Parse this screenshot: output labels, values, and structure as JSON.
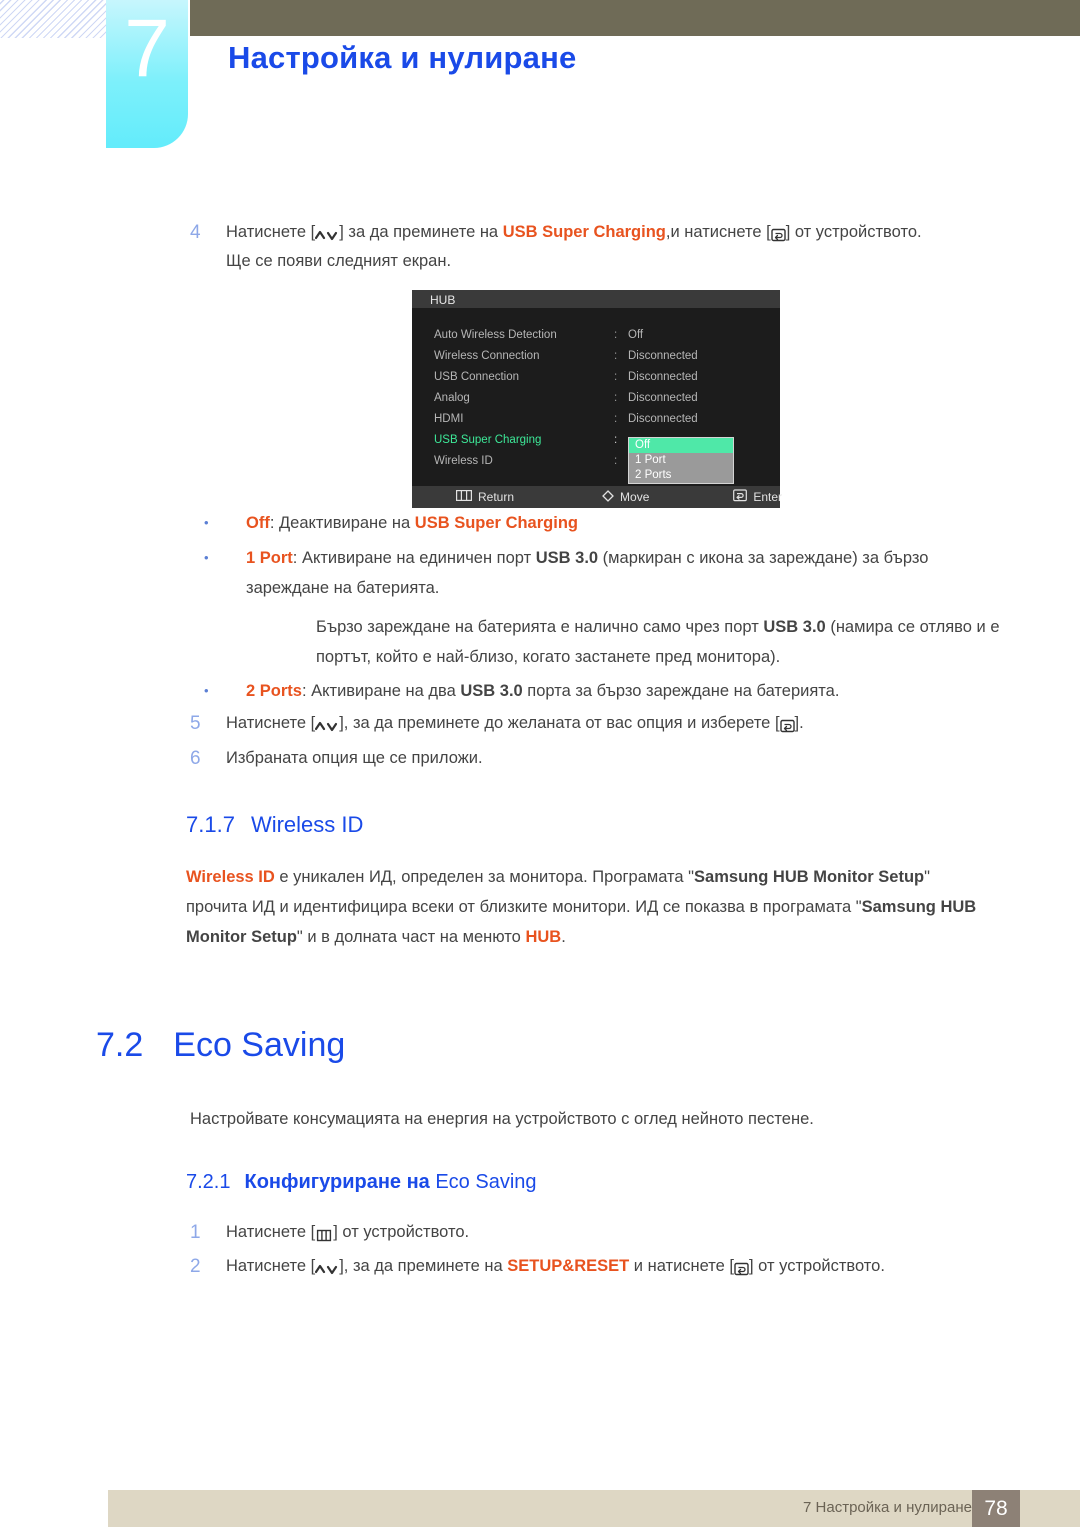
{
  "header": {
    "chapter_number": "7",
    "chapter_title": "Настройка и нулиране"
  },
  "steps_top": [
    {
      "num": "4",
      "line1_a": "Натиснете [",
      "line1_key": "updown-key-icon",
      "line1_b": "] за да преминете на ",
      "line1_highlight": "USB Super Charging",
      "line1_c": ",и натиснете [",
      "line1_key2": "enter-key-icon",
      "line1_d": "] от устройството.",
      "line2": "Ще се появи следният екран."
    }
  ],
  "osd": {
    "title": "HUB",
    "rows": [
      {
        "label": "Auto Wireless Detection",
        "colon": ":",
        "value": "Off",
        "active": false
      },
      {
        "label": "Wireless Connection",
        "colon": ":",
        "value": "Disconnected",
        "active": false
      },
      {
        "label": "USB Connection",
        "colon": ":",
        "value": "Disconnected",
        "active": false
      },
      {
        "label": "Analog",
        "colon": ":",
        "value": "Disconnected",
        "active": false
      },
      {
        "label": "HDMI",
        "colon": ":",
        "value": "Disconnected",
        "active": false
      },
      {
        "label": "USB Super Charging",
        "colon": ":",
        "value": "",
        "active": true
      },
      {
        "label": "Wireless ID",
        "colon": ":",
        "value": "",
        "active": false
      }
    ],
    "dropdown": {
      "options": [
        "Off",
        "1 Port",
        "2 Ports"
      ],
      "selected": "Off"
    },
    "footer": [
      {
        "icon": "menu-key-icon",
        "label": "Return"
      },
      {
        "icon": "move-diamond-icon",
        "label": "Move"
      },
      {
        "icon": "enter-key-icon",
        "label": "Enter"
      }
    ]
  },
  "bullets": [
    {
      "marker": "•",
      "term": "Off",
      "sep": ": ",
      "text_a": "Деактивиране на ",
      "highlight": "USB Super Charging",
      "text_b": ""
    },
    {
      "marker": "•",
      "term": "1 Port",
      "sep": ": ",
      "text_a": "Активиране на единичен порт ",
      "bold": "USB 3.0",
      "text_b": " (маркиран с икона за зареждане) за бързо зареждане на батерията."
    },
    {
      "marker": "•",
      "term": "2 Ports",
      "sep": ": ",
      "text_a": "Активиране на два ",
      "bold": "USB 3.0",
      "text_b": " порта за бързо зареждане на батерията."
    }
  ],
  "note": {
    "text_a": "Бързо зареждане на батерията е налично само чрез порт ",
    "bold": "USB 3.0",
    "text_b": " (намира се отляво и е портът, който е най-близо, когато застанете пред монитора)."
  },
  "steps_mid": [
    {
      "num": "5",
      "text_a": "Натиснете [",
      "key1": "updown-key-icon",
      "text_b": "], за да преминете до желаната от вас опция и изберете [",
      "key2": "enter-key-icon",
      "text_c": "]."
    },
    {
      "num": "6",
      "text_a": "Избраната опция ще се приложи.",
      "text_b": "",
      "text_c": ""
    }
  ],
  "section_717": {
    "number": "7.1.7",
    "title": "Wireless ID",
    "body_highlight": "Wireless ID",
    "body_a": " е уникален ИД, определен за монитора. Програмата \"",
    "body_bold1": "Samsung HUB Monitor Setup",
    "body_b": "\" прочита ИД и идентифицира всеки от близките монитори. ИД се показва в програмата \"",
    "body_bold2": "Samsung HUB Monitor Setup",
    "body_c": "\" и в долната част на менюто ",
    "body_highlight2": "HUB",
    "body_d": "."
  },
  "section_72": {
    "number": "7.2",
    "title": "Eco Saving",
    "intro": "Настройвате консумацията на енергия на устройството с оглед нейното пестене."
  },
  "section_721": {
    "number": "7.2.1",
    "title_bold": "Конфигуриране на ",
    "title_plain": "Eco Saving"
  },
  "steps_bottom": [
    {
      "num": "1",
      "text_a": "Натиснете [",
      "key1": "menu-key-icon",
      "text_b": "] от устройството.",
      "highlight": "",
      "key2": "",
      "text_c": ""
    },
    {
      "num": "2",
      "text_a": "Натиснете [",
      "key1": "updown-key-icon",
      "text_b": "], за да преминете на ",
      "highlight": "SETUP&RESET",
      "text_b2": " и натиснете [",
      "key2": "enter-key-icon",
      "text_c": "] от устройството."
    }
  ],
  "footer": {
    "chapter_label": "7 Настройка и нулиране",
    "page_number": "78"
  },
  "colors": {
    "accent_blue": "#1a4ae8",
    "highlight_orange": "#e8531f",
    "tab_cyan": "#7df0fb",
    "olive": "#6f6b57",
    "footer_beige": "#ded7c4",
    "footer_page_box": "#8d8176",
    "osd_green": "#3de898"
  }
}
